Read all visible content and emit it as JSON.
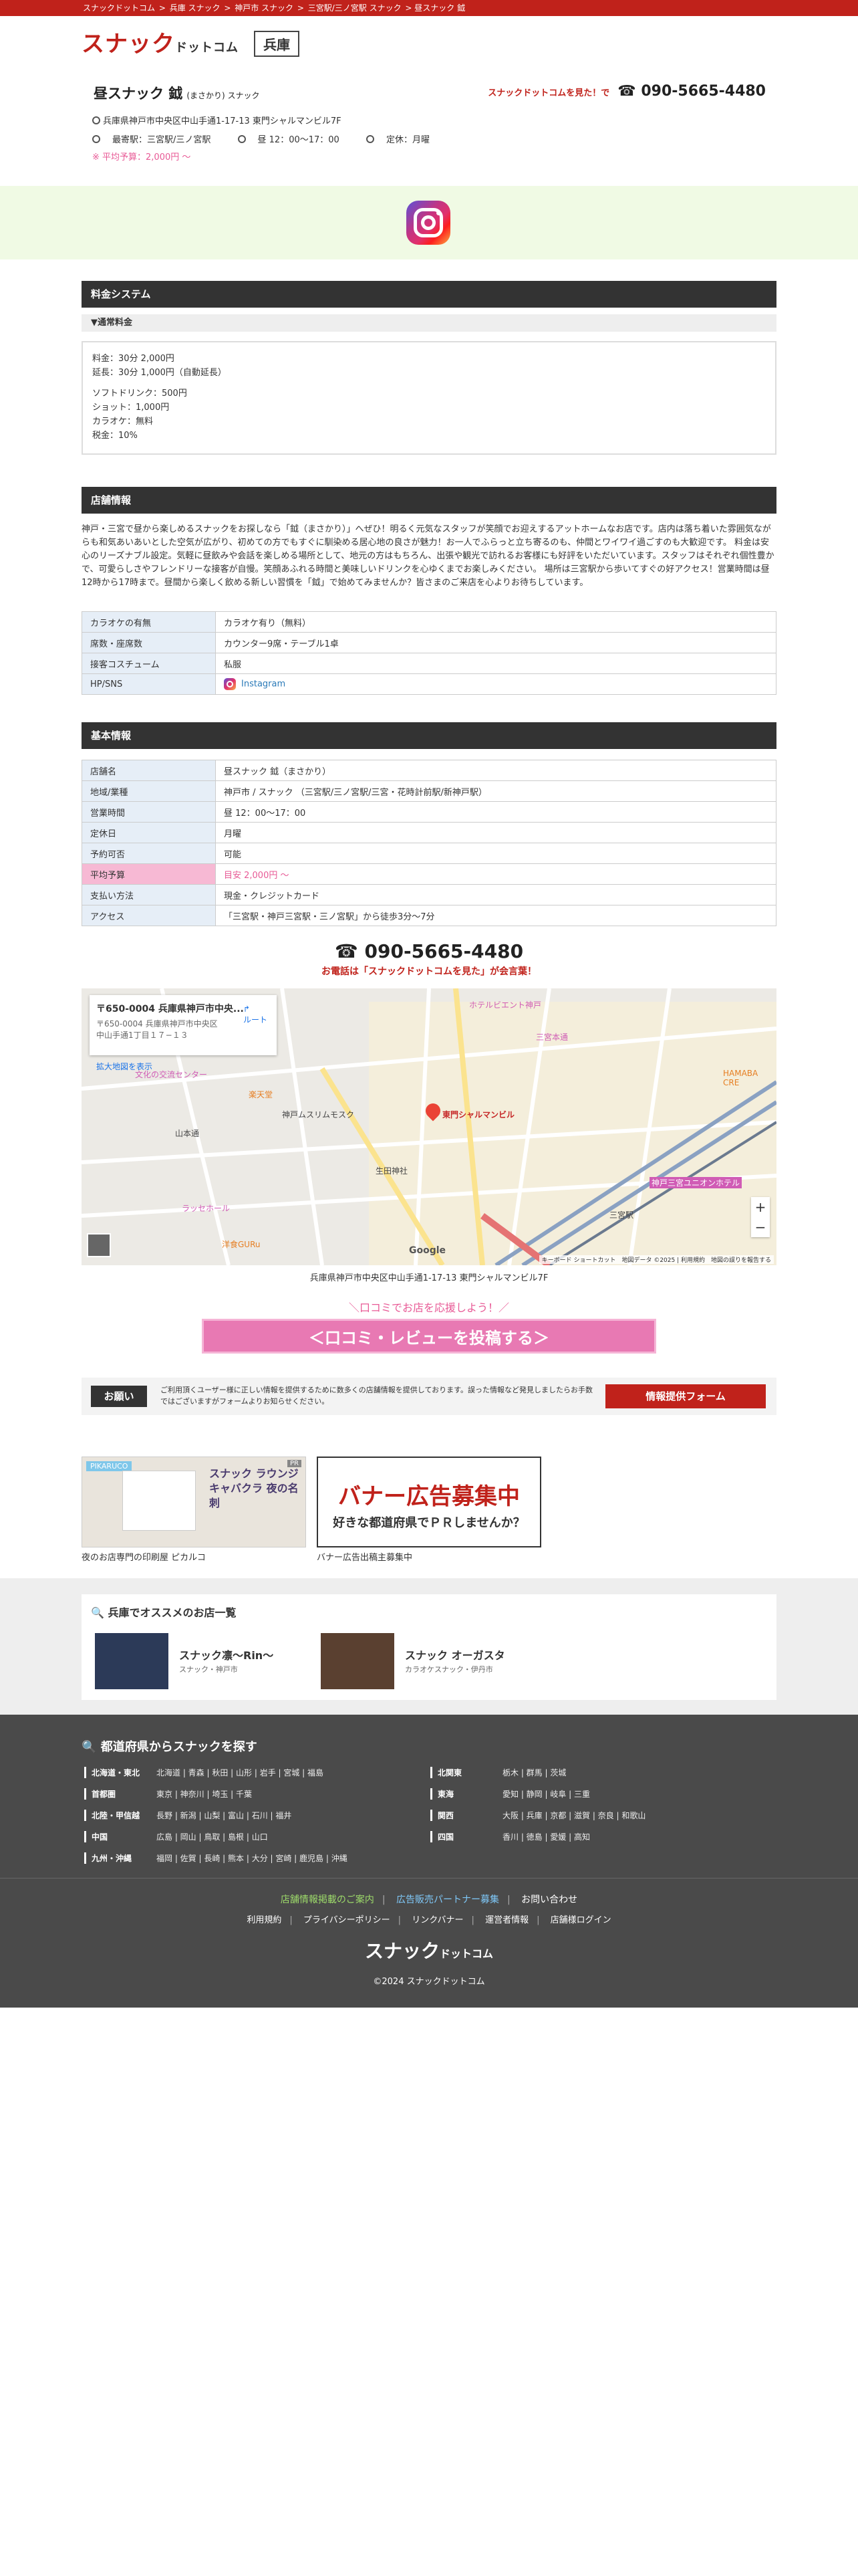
{
  "breadcrumb": [
    "スナックドットコム",
    "兵庫 スナック",
    "神戸市 スナック",
    "三宮駅/三ノ宮駅 スナック",
    "昼スナック 鉞"
  ],
  "header": {
    "logo_main": "スナック",
    "logo_sub": "ドットコム",
    "pref": "兵庫"
  },
  "shop": {
    "name": "昼スナック 鉞",
    "ruby": "(まさかり) スナック",
    "tel_msg": "スナックドットコムを見た！で",
    "tel": "☎ 090-5665-4480",
    "address": "兵庫県神戸市中央区中山手通1-17-13 東門シャルマンビル7F",
    "station": "最寄駅：三宮駅/三ノ宮駅",
    "hours": "昼 12：00〜17：00",
    "holiday": "定休：月曜",
    "avg": "※ 平均予算：2,000円 〜"
  },
  "price": {
    "title": "料金システム",
    "sub": "▼通常料金",
    "lines": [
      "料金：30分 2,000円",
      "延長：30分 1,000円（自動延長）",
      "",
      "ソフトドリンク：500円",
      "ショット：1,000円",
      "カラオケ：無料",
      "税金：10%"
    ]
  },
  "store": {
    "title": "店舗情報",
    "desc": "神戸・三宮で昼から楽しめるスナックをお探しなら「鉞（まさかり）」へぜひ！明るく元気なスタッフが笑顔でお迎えするアットホームなお店です。店内は落ち着いた雰囲気ながらも和気あいあいとした空気が広がり、初めての方でもすぐに馴染める居心地の良さが魅力！お一人でふらっと立ち寄るのも、仲間とワイワイ過ごすのも大歓迎です。 料金は安心のリーズナブル設定。気軽に昼飲みや会話を楽しめる場所として、地元の方はもちろん、出張や観光で訪れるお客様にも好評をいただいています。スタッフはそれぞれ個性豊かで、可愛らしさやフレンドリーな接客が自慢。笑顔あふれる時間と美味しいドリンクを心ゆくまでお楽しみください。 場所は三宮駅から歩いてすぐの好アクセス！営業時間は昼12時から17時まで。昼間から楽しく飲める新しい習慣を「鉞」で始めてみませんか？皆さまのご来店を心よりお待ちしています。",
    "rows": [
      [
        "カラオケの有無",
        "カラオケ有り（無料）"
      ],
      [
        "席数・座席数",
        "カウンター9席・テーブル1卓"
      ],
      [
        "接客コスチューム",
        "私服"
      ],
      [
        "HP/SNS",
        "Instagram"
      ]
    ]
  },
  "basic": {
    "title": "基本情報",
    "rows": [
      [
        "店舗名",
        "昼スナック 鉞（まさかり）"
      ],
      [
        "地域/業種",
        "神戸市 / スナック （三宮駅/三ノ宮駅/三宮・花時計前駅/新神戸駅）"
      ],
      [
        "営業時間",
        "昼 12：00〜17：00"
      ],
      [
        "定休日",
        "月曜"
      ],
      [
        "予約可否",
        "可能"
      ],
      [
        "平均予算",
        "目安 2,000円 〜"
      ],
      [
        "支払い方法",
        "現金・クレジットカード"
      ],
      [
        "アクセス",
        "「三宮駅・神戸三宮駅・三ノ宮駅」から徒歩3分〜7分"
      ]
    ]
  },
  "contact": {
    "tel": "☎ 090-5665-4480",
    "note": "お電話は「スナックドットコムを見た」が会言葉！"
  },
  "map": {
    "card_title": "〒650-0004 兵庫県神戸市中央...",
    "card_addr": "〒650-0004 兵庫県神戸市中央区中山手通1丁目１７−１３",
    "route": "ルート",
    "enlarge": "拡大地図を表示",
    "labels": [
      "ホテルビエント神戸",
      "三宮本通",
      "東門シャルマンビル",
      "楽天堂",
      "神戸ムスリムモスク",
      "山本通",
      "ラッセホール",
      "生田神社",
      "洋食GURu",
      "神戸三宮ユニオンホテル",
      "三宮駅",
      "HAMABA CRE",
      "文化の交流センター",
      "Google"
    ],
    "footer": "キーボード ショートカット　地図データ ©2025 | 利用規約　地図の誤りを報告する",
    "address": "兵庫県神戸市中央区中山手通1-17-13 東門シャルマンビル7F"
  },
  "review": {
    "note": "＼口コミでお店を応援しよう！／",
    "button": "＜口コミ・レビューを投稿する＞"
  },
  "notice": {
    "tag": "お願い",
    "text": "ご利用頂くユーザー様に正しい情報を提供するために数多くの店舗情報を提供しております。誤った情報など発見しましたらお手数ではございますがフォームよりお知らせください。",
    "button": "情報提供フォーム"
  },
  "banners": [
    {
      "caption": "夜のお店専門の印刷屋 ピカルコ",
      "text": "スナック ラウンジ キャバクラ 夜の名刺",
      "brand": "PIKARUCO",
      "tag": "PR"
    },
    {
      "caption": "バナー広告出稿主募集中",
      "title": "バナー広告募集中",
      "sub": "好きな都道府県でＰＲしませんか？"
    }
  ],
  "recommend": {
    "title": "兵庫でオススメのお店一覧",
    "items": [
      {
        "name": "スナック凛〜Rin〜",
        "sub": "スナック・神戸市"
      },
      {
        "name": "スナック オーガスタ",
        "sub": "カラオケスナック・伊丹市"
      }
    ]
  },
  "footer": {
    "title": "都道府県からスナックを探す",
    "regions_left": [
      [
        "北海道・東北",
        "北海道 | 青森 | 秋田 | 山形 | 岩手 | 宮城 | 福島"
      ],
      [
        "首都圏",
        "東京 | 神奈川 | 埼玉 | 千葉"
      ],
      [
        "北陸・甲信越",
        "長野 | 新潟 | 山梨 | 富山 | 石川 | 福井"
      ],
      [
        "中国",
        "広島 | 岡山 | 鳥取 | 島根 | 山口"
      ],
      [
        "九州・沖縄",
        "福岡 | 佐賀 | 長崎 | 熊本 | 大分 | 宮崎 | 鹿児島 | 沖縄"
      ]
    ],
    "regions_right": [
      [
        "北関東",
        "栃木 | 群馬 | 茨城"
      ],
      [
        "東海",
        "愛知 | 静岡 | 岐阜 | 三重"
      ],
      [
        "関西",
        "大阪 | 兵庫 | 京都 | 滋賀 | 奈良 | 和歌山"
      ],
      [
        "四国",
        "香川 | 徳島 | 愛媛 | 高知"
      ]
    ],
    "links1": [
      "店舗情報掲載のご案内",
      "広告販売パートナー募集",
      "お問い合わせ"
    ],
    "links2": [
      "利用規約",
      "プライバシーポリシー",
      "リンクバナー",
      "運営者情報",
      "店舗様ログイン"
    ],
    "logo_main": "スナック",
    "logo_sub": "ドットコム",
    "copyright": "©2024 スナックドットコム"
  },
  "colors": {
    "brand": "#c0221b",
    "accent_pink": "#e879b3",
    "header_dark": "#333333",
    "footer_bg": "#4a4a4a"
  }
}
